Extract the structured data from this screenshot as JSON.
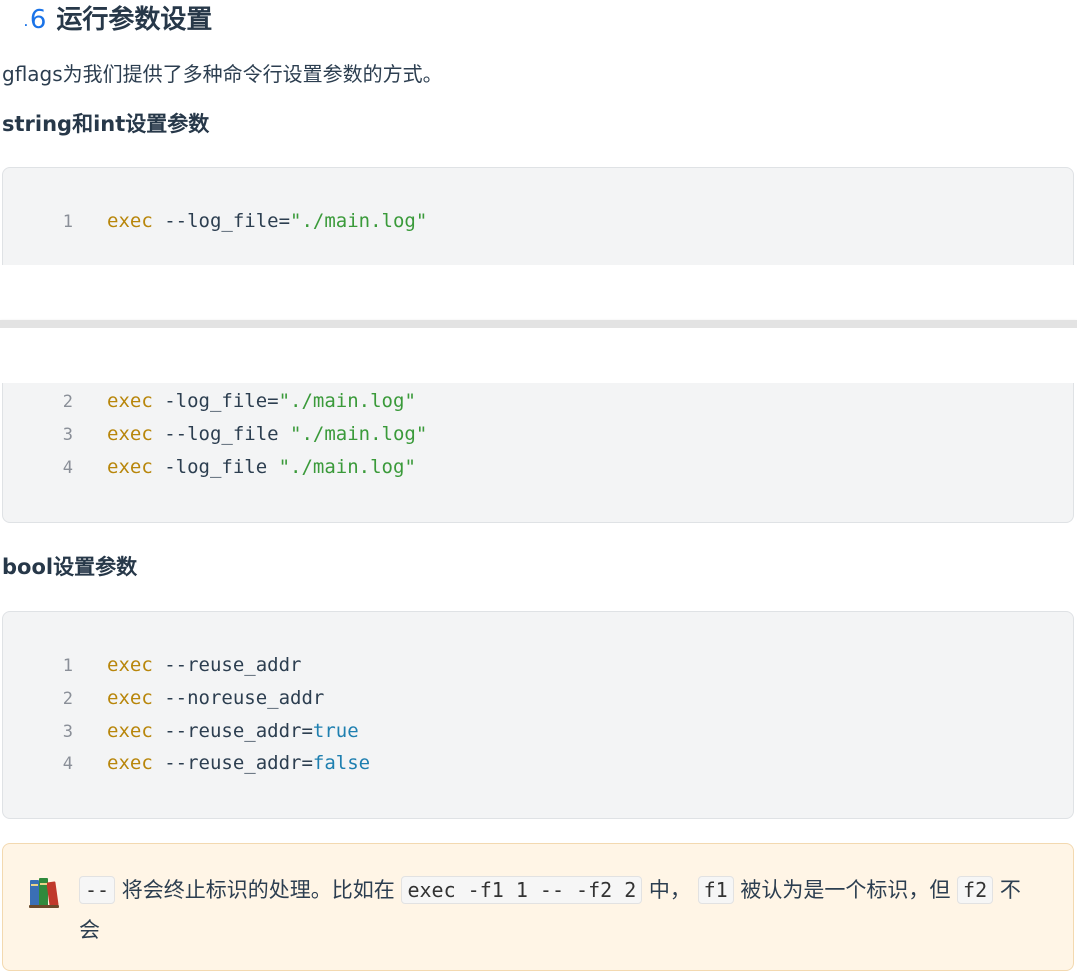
{
  "heading": {
    "prefix": ".",
    "number": "6",
    "title": "运行参数设置"
  },
  "intro": "gflags为我们提供了多种命令行设置参数的方式。",
  "section1": {
    "title": "string和int设置参数",
    "lines": [
      {
        "n": "1",
        "cmd": "exec",
        "arg": " --log_file=",
        "val": "\"./main.log\""
      },
      {
        "n": "2",
        "cmd": "exec",
        "arg": " -log_file=",
        "val": "\"./main.log\""
      },
      {
        "n": "3",
        "cmd": "exec",
        "arg": " --log_file ",
        "val": "\"./main.log\""
      },
      {
        "n": "4",
        "cmd": "exec",
        "arg": " -log_file ",
        "val": "\"./main.log\""
      }
    ]
  },
  "section2": {
    "title": "bool设置参数",
    "lines": [
      {
        "n": "1",
        "cmd": "exec",
        "arg": " --reuse_addr",
        "val": ""
      },
      {
        "n": "2",
        "cmd": "exec",
        "arg": " --noreuse_addr",
        "val": ""
      },
      {
        "n": "3",
        "cmd": "exec",
        "arg": " --reuse_addr=",
        "val": "true"
      },
      {
        "n": "4",
        "cmd": "exec",
        "arg": " --reuse_addr=",
        "val": "false"
      }
    ]
  },
  "tip": {
    "icon": "books-icon",
    "code1": "--",
    "text1": " 将会终止标识的处理。比如在 ",
    "code2": "exec -f1 1 -- -f2 2",
    "text2": " 中， ",
    "code3": "f1",
    "text3": " 被认为是一个标识，但 ",
    "code4": "f2",
    "text4": " 不会"
  }
}
